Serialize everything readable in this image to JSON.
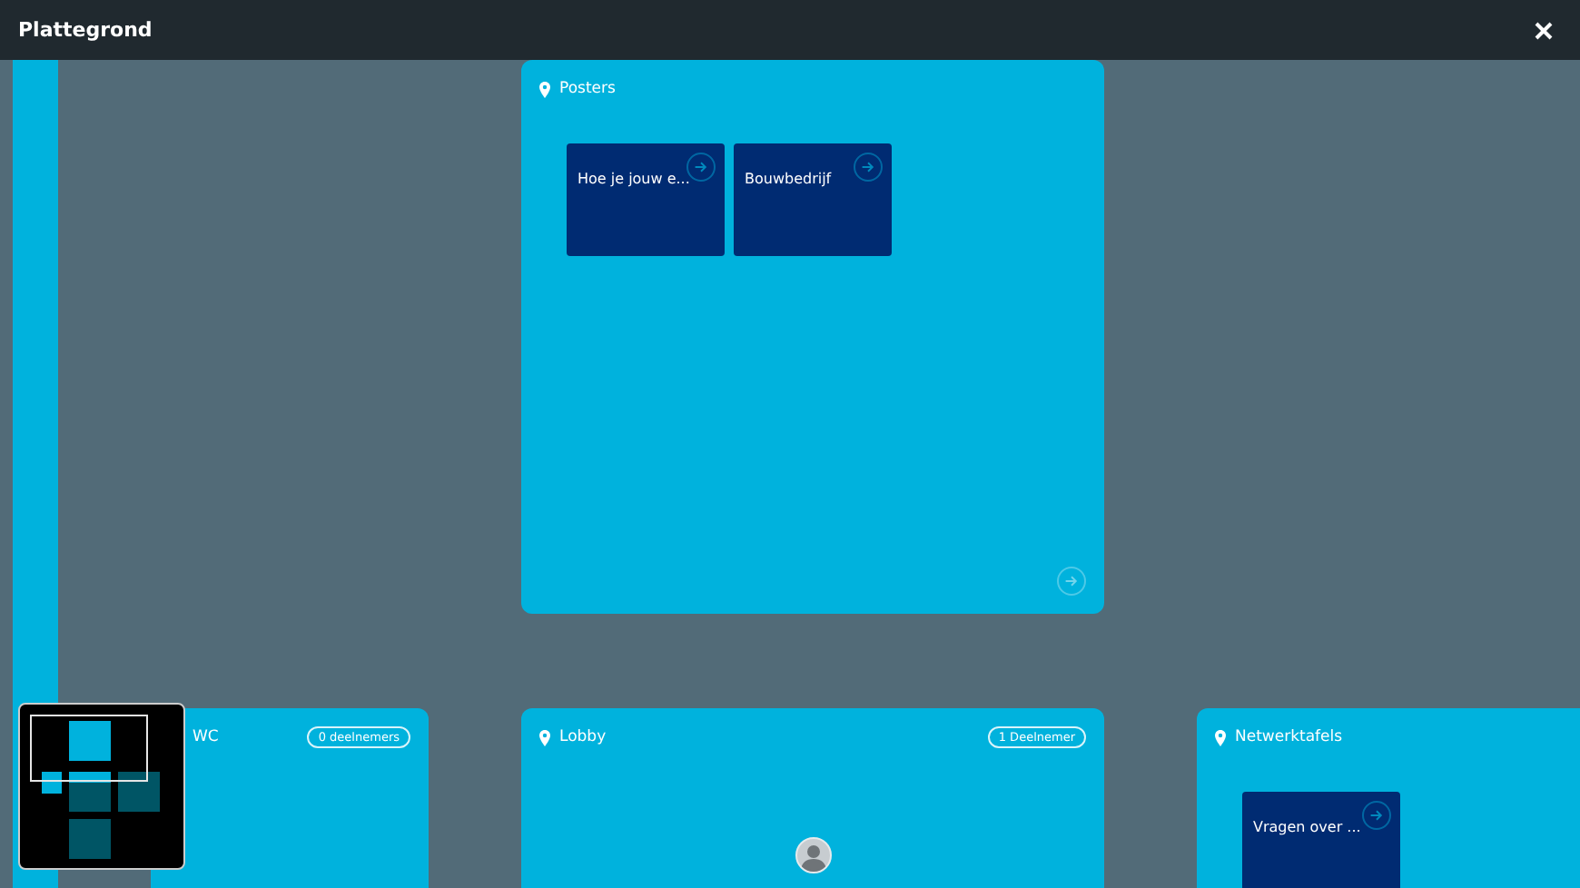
{
  "window": {
    "title": "Plattegrond"
  },
  "rooms": [
    {
      "name": "Posters",
      "pin": true,
      "sessions": [
        {
          "title": "Hoe je jouw e..."
        },
        {
          "title": "Bouwbedrijf"
        }
      ],
      "more_button": true
    },
    {
      "name": "WC",
      "pin": false,
      "badge": "0 deelnemers"
    },
    {
      "name": "Lobby",
      "pin": true,
      "badge": "1 Deelnemer",
      "participants": [
        {
          "kind": "avatar"
        }
      ]
    },
    {
      "name": "Netwerktafels",
      "pin": true,
      "sessions": [
        {
          "title": "Vragen over ..."
        }
      ]
    }
  ]
}
